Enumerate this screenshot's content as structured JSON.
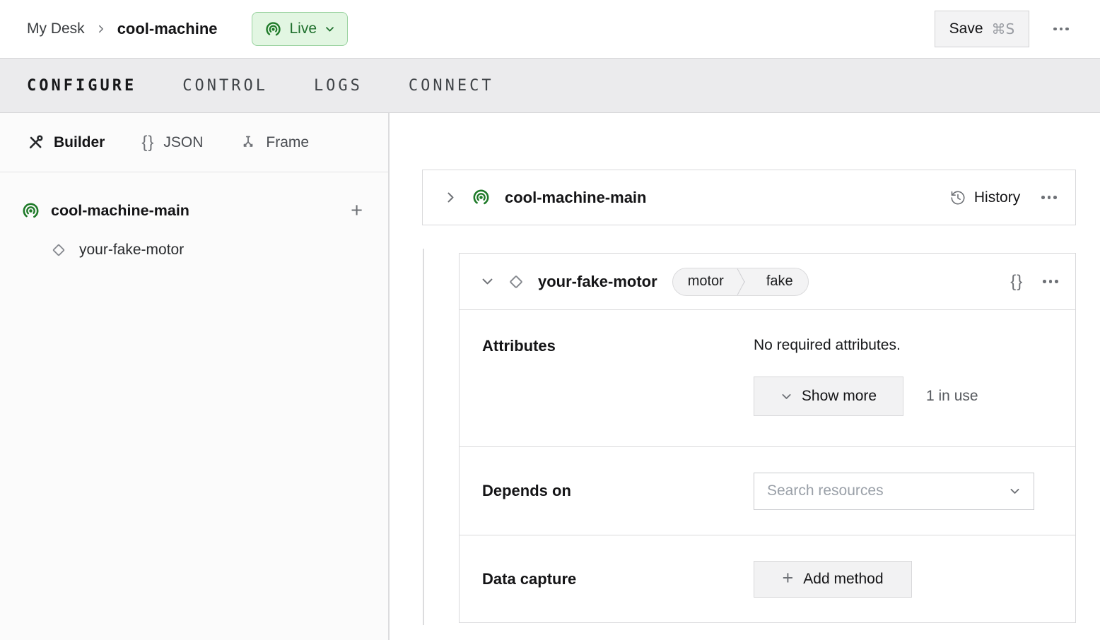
{
  "icons": {
    "plus": "+",
    "braces": "{}"
  },
  "topbar": {
    "breadcrumb": {
      "root": "My Desk",
      "current": "cool-machine"
    },
    "live_badge": "Live",
    "save_label": "Save",
    "save_shortcut": "⌘S"
  },
  "tabs": [
    {
      "label": "CONFIGURE",
      "active": true
    },
    {
      "label": "CONTROL",
      "active": false
    },
    {
      "label": "LOGS",
      "active": false
    },
    {
      "label": "CONNECT",
      "active": false
    }
  ],
  "sidebar": {
    "views": [
      {
        "label": "Builder",
        "active": true
      },
      {
        "label": "JSON",
        "active": false
      },
      {
        "label": "Frame",
        "active": false
      }
    ],
    "tree": {
      "part": "cool-machine-main",
      "component": "your-fake-motor"
    }
  },
  "main": {
    "part_card": {
      "title": "cool-machine-main",
      "history": "History"
    },
    "component_card": {
      "title": "your-fake-motor",
      "type_badge": "motor",
      "model_badge": "fake",
      "attributes": {
        "label": "Attributes",
        "empty_text": "No required attributes.",
        "show_more": "Show more",
        "in_use": "1 in use"
      },
      "depends_on": {
        "label": "Depends on",
        "placeholder": "Search resources"
      },
      "data_capture": {
        "label": "Data capture",
        "add_method": "Add method"
      }
    }
  },
  "colors": {
    "accent_green": "#1e7a28",
    "live_bg": "#e2f6e2",
    "live_border": "#99d29f",
    "live_text": "#1f6f2d",
    "card_border": "#d9d9db",
    "tabbar_bg": "#ebebed"
  }
}
